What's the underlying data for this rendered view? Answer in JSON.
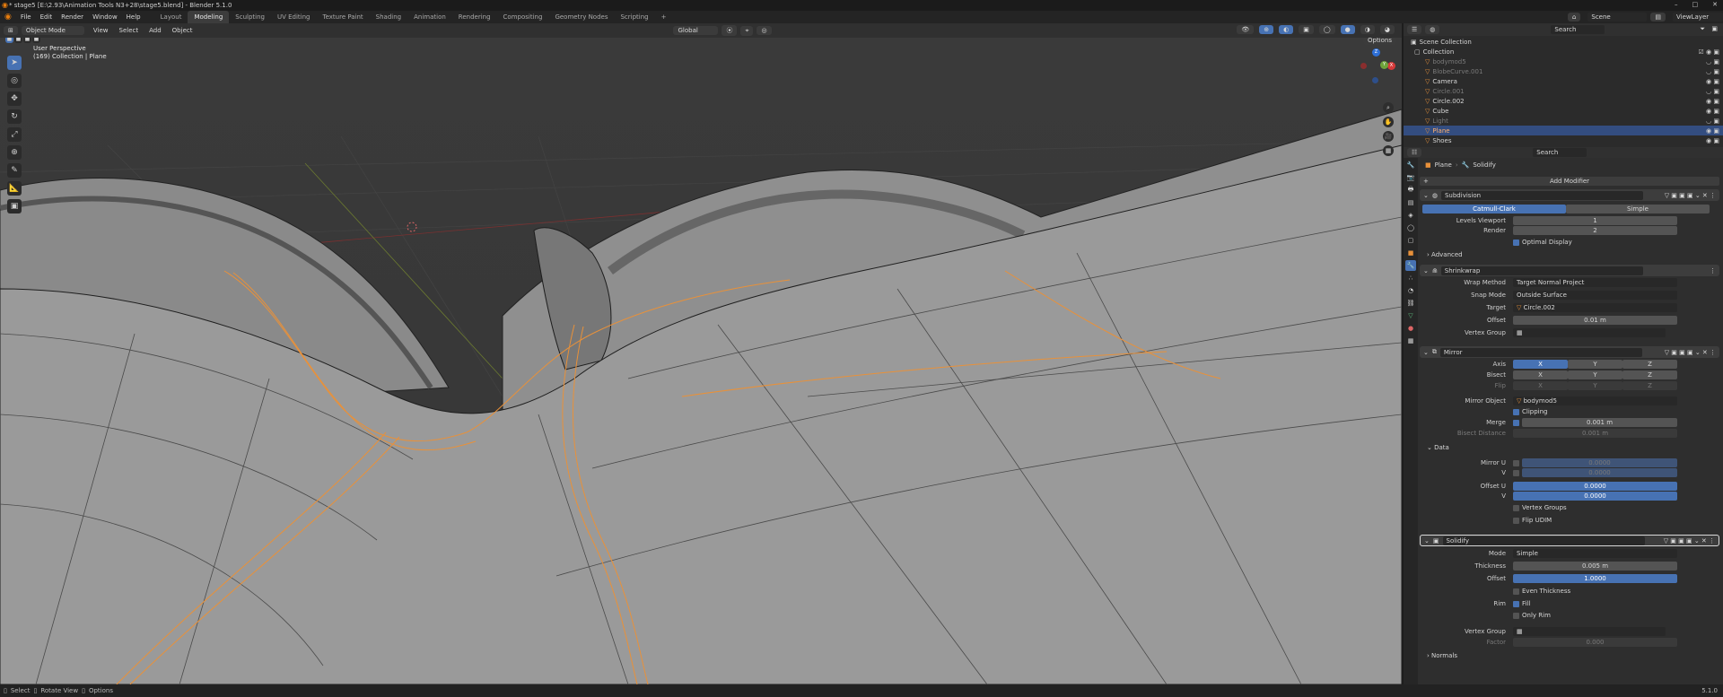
{
  "window": {
    "title": "* stage5 [E:\\2.93\\Animation Tools N3+28\\stage5.blend] - Blender 5.1.0",
    "controls": [
      "–",
      "□",
      "✕"
    ]
  },
  "menubar": {
    "menus": [
      "File",
      "Edit",
      "Render",
      "Window",
      "Help"
    ],
    "workspaces": [
      "Layout",
      "Modeling",
      "Sculpting",
      "UV Editing",
      "Texture Paint",
      "Shading",
      "Animation",
      "Rendering",
      "Compositing",
      "Geometry Nodes",
      "Scripting"
    ],
    "active_workspace": "Modeling",
    "scene": "Scene",
    "view_layer": "ViewLayer"
  },
  "viewport_header": {
    "mode": "Object Mode",
    "menus": [
      "View",
      "Select",
      "Add",
      "Object"
    ],
    "orientation": "Global",
    "options": "Options"
  },
  "viewport": {
    "perspective_label": "User Perspective",
    "collection_label": "(169) Collection | Plane",
    "gizmo_axes": [
      "X",
      "Y",
      "Z"
    ]
  },
  "outliner": {
    "search_placeholder": "Search",
    "root": "Scene Collection",
    "collection": "Collection",
    "items": [
      {
        "name": "bodymod5",
        "dim": true
      },
      {
        "name": "BlobeCurve.001",
        "dim": true
      },
      {
        "name": "Camera",
        "dim": false
      },
      {
        "name": "Circle.001",
        "dim": true
      },
      {
        "name": "Circle.002",
        "dim": false
      },
      {
        "name": "Cube",
        "dim": false
      },
      {
        "name": "Light",
        "dim": true
      },
      {
        "name": "Plane",
        "dim": false,
        "selected": true
      },
      {
        "name": "Shoes",
        "dim": false
      }
    ]
  },
  "properties": {
    "search_placeholder": "Search",
    "breadcrumb": [
      "Plane",
      "Solidify"
    ],
    "add_modifier": "Add Modifier",
    "subdivision": {
      "name": "Subdivision",
      "tabs": [
        "Catmull-Clark",
        "Simple"
      ],
      "levels_viewport_label": "Levels Viewport",
      "levels_viewport": "1",
      "render_label": "Render",
      "render": "2",
      "optimal_display": "Optimal Display",
      "advanced": "Advanced"
    },
    "shrinkwrap": {
      "name": "Shrinkwrap",
      "wrap_method_label": "Wrap Method",
      "wrap_method": "Target Normal Project",
      "snap_mode_label": "Snap Mode",
      "snap_mode": "Outside Surface",
      "target_label": "Target",
      "target": "Circle.002",
      "offset_label": "Offset",
      "offset": "0.01 m",
      "vertex_group_label": "Vertex Group"
    },
    "mirror": {
      "name": "Mirror",
      "axis_label": "Axis",
      "bisect_label": "Bisect",
      "flip_label": "Flip",
      "axes": [
        "X",
        "Y",
        "Z"
      ],
      "mirror_object_label": "Mirror Object",
      "mirror_object": "bodymod5",
      "clipping": "Clipping",
      "merge_label": "Merge",
      "merge": "0.001 m",
      "bisect_distance_label": "Bisect Distance",
      "bisect_distance": "0.001 m",
      "data_label": "Data",
      "mirror_u_label": "Mirror U",
      "mirror_u": "0.0000",
      "v_label": "V",
      "mirror_v": "0.0000",
      "offset_u_label": "Offset U",
      "offset_u": "0.0000",
      "offset_v": "0.0000",
      "vertex_groups": "Vertex Groups",
      "flip_udim": "Flip UDIM"
    },
    "solidify": {
      "name": "Solidify",
      "mode_label": "Mode",
      "mode": "Simple",
      "thickness_label": "Thickness",
      "thickness": "0.005 m",
      "offset_label": "Offset",
      "offset": "1.0000",
      "even_thickness": "Even Thickness",
      "rim_label": "Rim",
      "fill": "Fill",
      "only_rim": "Only Rim",
      "vertex_group_label": "Vertex Group",
      "factor_label": "Factor",
      "factor": "0.000",
      "normals": "Normals"
    }
  },
  "statusbar": {
    "items": [
      "Select",
      "Rotate View",
      "Options"
    ],
    "version": "5.1.0"
  },
  "colors": {
    "accent": "#4772b3",
    "selection_orange": "#e8913a",
    "panel_bg": "#2e2e2e",
    "viewport_bg": "#393939"
  }
}
